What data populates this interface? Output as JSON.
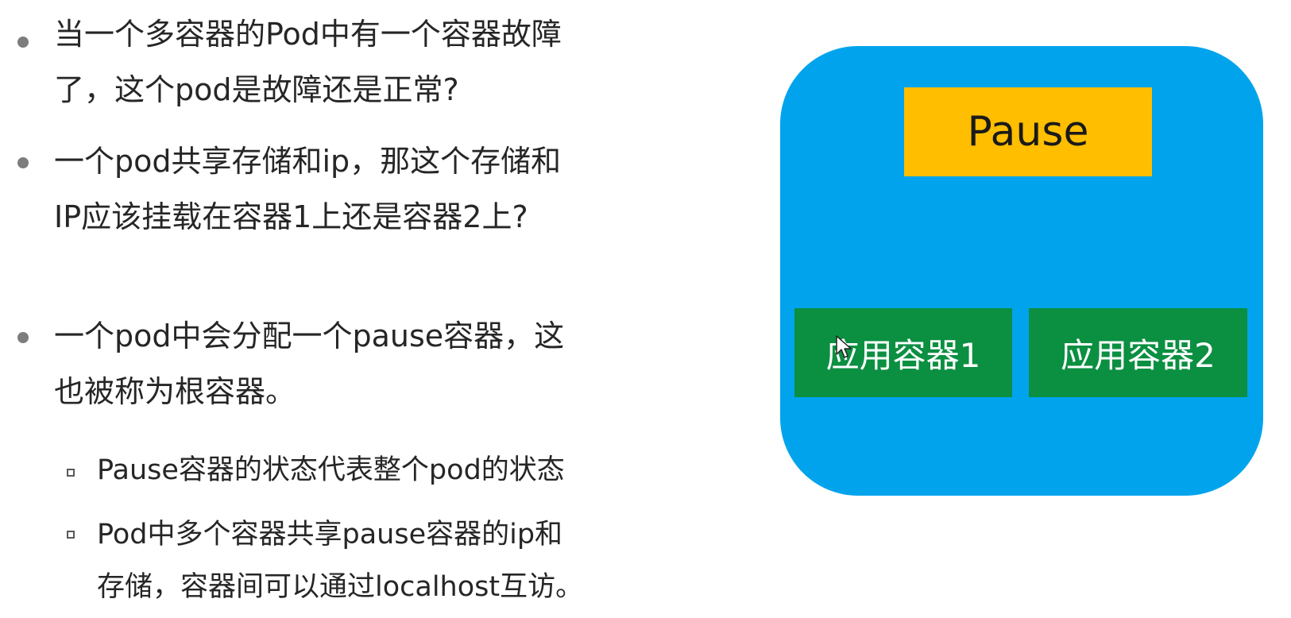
{
  "bullets": [
    {
      "lines": [
        "当一个多容器的Pod中有一个容器故障",
        "了，这个pod是故障还是正常?"
      ]
    },
    {
      "lines": [
        "一个pod共享存储和ip，那这个存储和",
        "IP应该挂载在容器1上还是容器2上?"
      ]
    },
    {
      "lines": [
        "一个pod中会分配一个pause容器，这",
        "也被称为根容器。"
      ]
    }
  ],
  "sub_bullets": [
    {
      "lines": [
        "Pause容器的状态代表整个pod的状态"
      ]
    },
    {
      "lines": [
        "Pod中多个容器共享pause容器的ip和",
        "存储，容器间可以通过localhost互访。"
      ]
    }
  ],
  "diagram": {
    "pause_label": "Pause",
    "app1_label": "应用容器1",
    "app2_label": "应用容器2",
    "colors": {
      "pod": "#01a4ec",
      "pause": "#ffbe00",
      "app": "#0b8f41"
    }
  },
  "icons": {
    "bullet": "filled-circle",
    "sub_bullet": "hollow-square",
    "cursor": "mouse-pointer-icon"
  }
}
